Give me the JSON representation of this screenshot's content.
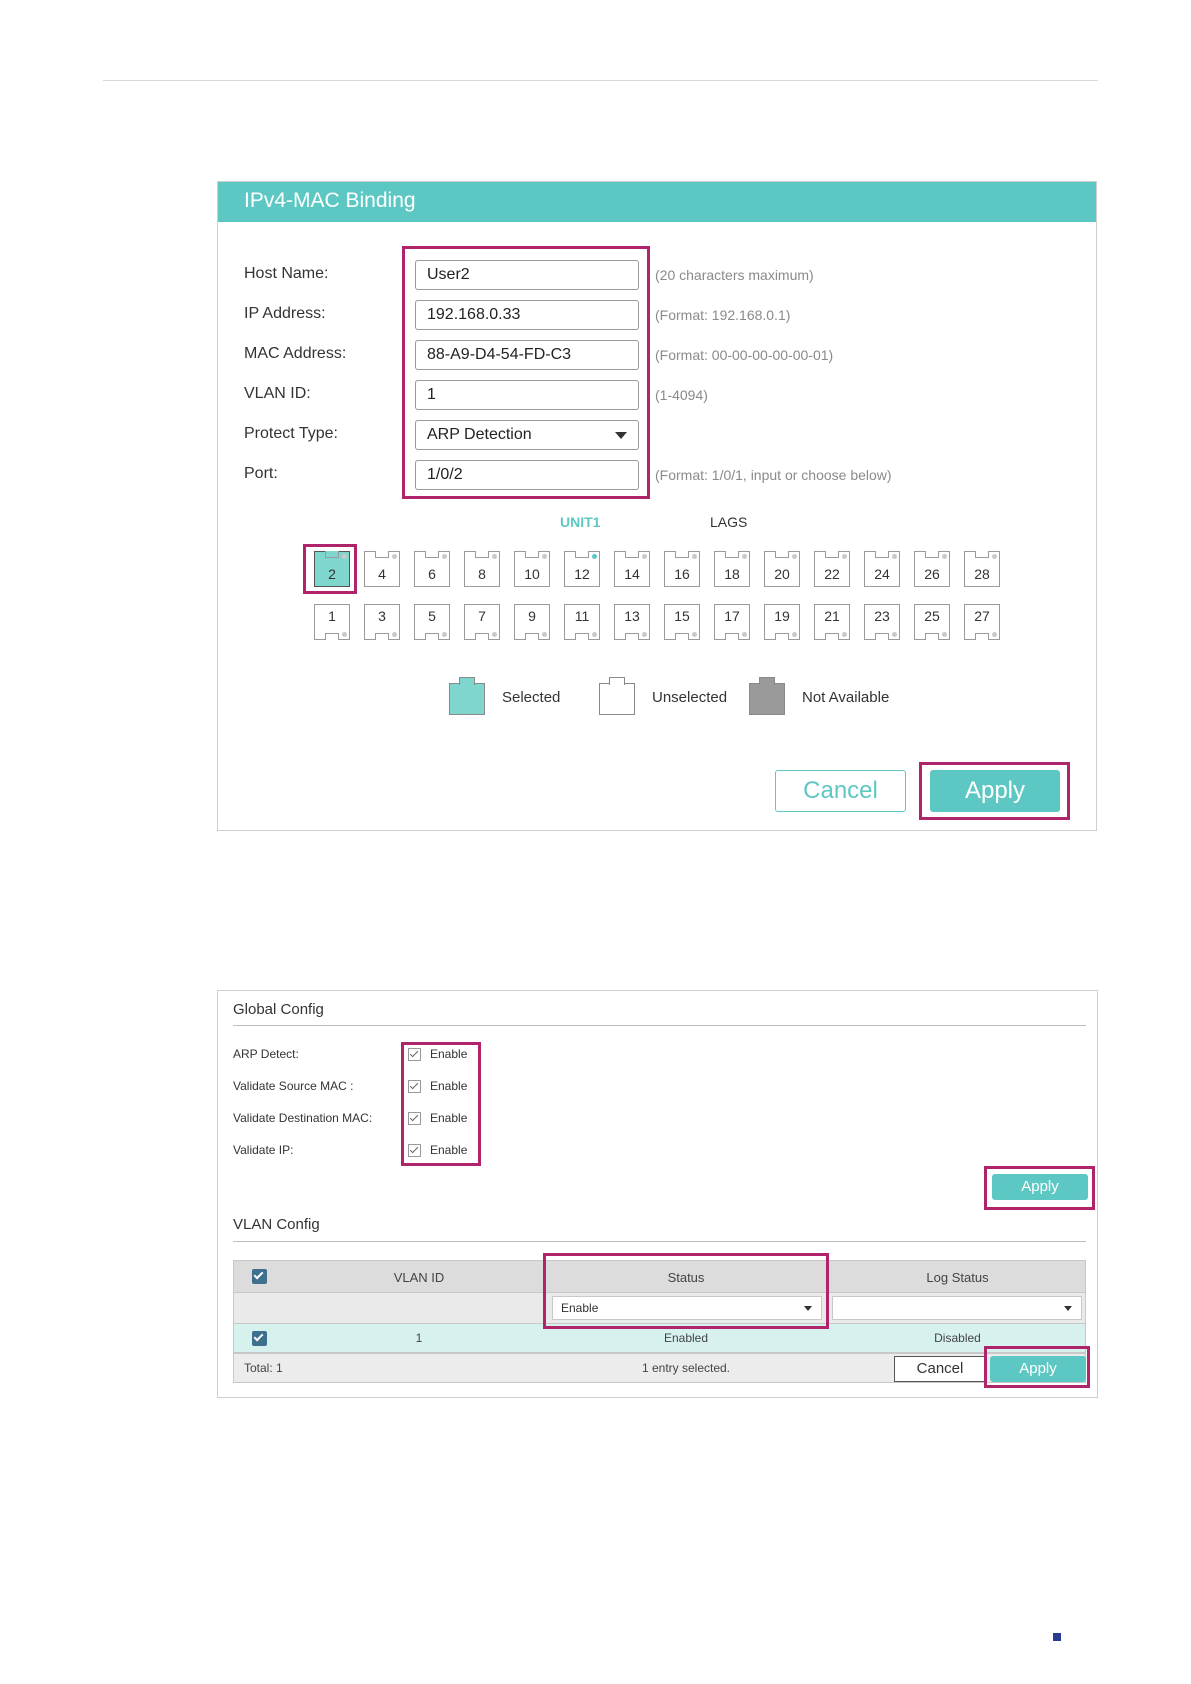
{
  "binding_form": {
    "title": "IPv4-MAC Binding",
    "fields": [
      {
        "label": "Host Name:",
        "value": "User2",
        "hint": "(20 characters maximum)"
      },
      {
        "label": "IP Address:",
        "value": "192.168.0.33",
        "hint": "(Format: 192.168.0.1)"
      },
      {
        "label": "MAC Address:",
        "value": "88-A9-D4-54-FD-C3",
        "hint": "(Format: 00-00-00-00-00-01)"
      },
      {
        "label": "VLAN ID:",
        "value": "1",
        "hint": "(1-4094)"
      },
      {
        "label": "Protect Type:",
        "value": "ARP Detection",
        "hint": ""
      },
      {
        "label": "Port:",
        "value": "1/0/2",
        "hint": "(Format: 1/0/1, input or choose below)"
      }
    ],
    "tabs": {
      "unit": "UNIT1",
      "lags": "LAGS"
    },
    "ports_top": [
      "2",
      "4",
      "6",
      "8",
      "10",
      "12",
      "14",
      "16",
      "18",
      "20",
      "22",
      "24",
      "26",
      "28"
    ],
    "ports_bottom": [
      "1",
      "3",
      "5",
      "7",
      "9",
      "11",
      "13",
      "15",
      "17",
      "19",
      "21",
      "23",
      "25",
      "27"
    ],
    "selected_port": "2",
    "active_port": "12",
    "legend": {
      "selected": "Selected",
      "unselected": "Unselected",
      "not_available": "Not Available"
    },
    "legend_colors": {
      "selected": "#7fd6cf",
      "unselected": "#ffffff",
      "not_available": "#9a9a9a"
    },
    "cancel_label": "Cancel",
    "apply_label": "Apply"
  },
  "arp_panel": {
    "global_title": "Global Config",
    "global_rows": [
      {
        "label": "ARP Detect:",
        "checked": true,
        "text": "Enable"
      },
      {
        "label": "Validate Source MAC :",
        "checked": true,
        "text": "Enable"
      },
      {
        "label": "Validate Destination MAC:",
        "checked": true,
        "text": "Enable"
      },
      {
        "label": "Validate IP:",
        "checked": true,
        "text": "Enable"
      }
    ],
    "global_apply": "Apply",
    "vlan_title": "VLAN Config",
    "table": {
      "columns": [
        "VLAN ID",
        "Status",
        "Log Status"
      ],
      "filter": {
        "status": "Enable",
        "log_status": ""
      },
      "rows": [
        {
          "vlan_id": "1",
          "status": "Enabled",
          "log_status": "Disabled",
          "checked": true
        }
      ],
      "total": "Total: 1",
      "selected_info": "1 entry selected.",
      "cancel": "Cancel",
      "apply": "Apply"
    }
  },
  "colors": {
    "accent": "#5dc8c3",
    "highlight": "#b0246b",
    "checkbox": "#3d6f8e"
  }
}
